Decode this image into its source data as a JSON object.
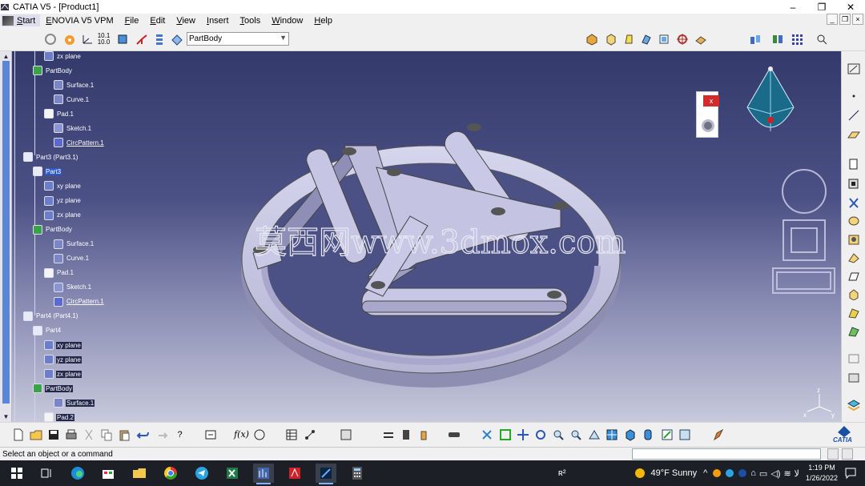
{
  "window": {
    "title": "CATIA V5 - [Product1]",
    "controls": [
      "–",
      "❐",
      "✕"
    ]
  },
  "menu": {
    "items": [
      "Start",
      "ENOVIA V5 VPM",
      "File",
      "Edit",
      "View",
      "Insert",
      "Tools",
      "Window",
      "Help"
    ]
  },
  "toolbar": {
    "combo_value": "PartBody"
  },
  "tree": {
    "nodes": [
      {
        "label": "zx plane",
        "icon": "plane-icon",
        "indent": 2
      },
      {
        "label": "PartBody",
        "icon": "partbody-icon",
        "indent": 1
      },
      {
        "label": "Surface.1",
        "icon": "surface-icon",
        "indent": 3
      },
      {
        "label": "Curve.1",
        "icon": "curve-icon",
        "indent": 3
      },
      {
        "label": "Pad.1",
        "icon": "pad-icon",
        "indent": 2
      },
      {
        "label": "Sketch.1",
        "icon": "sketch-icon",
        "indent": 3
      },
      {
        "label": "CircPattern.1",
        "icon": "pattern-icon",
        "indent": 3,
        "style": "link"
      },
      {
        "label": "Part3 (Part3.1)",
        "icon": "part-icon",
        "indent": 0
      },
      {
        "label": "Part3",
        "icon": "part-icon",
        "indent": 1,
        "style": "selected"
      },
      {
        "label": "xy plane",
        "icon": "plane-icon",
        "indent": 2
      },
      {
        "label": "yz plane",
        "icon": "plane-icon",
        "indent": 2
      },
      {
        "label": "zx plane",
        "icon": "plane-icon",
        "indent": 2
      },
      {
        "label": "PartBody",
        "icon": "partbody-icon",
        "indent": 1
      },
      {
        "label": "Surface.1",
        "icon": "surface-icon",
        "indent": 3
      },
      {
        "label": "Curve.1",
        "icon": "curve-icon",
        "indent": 3
      },
      {
        "label": "Pad.1",
        "icon": "pad-icon",
        "indent": 2
      },
      {
        "label": "Sketch.1",
        "icon": "sketch-icon",
        "indent": 3
      },
      {
        "label": "CircPattern.1",
        "icon": "pattern-icon",
        "indent": 3,
        "style": "link"
      },
      {
        "label": "Part4 (Part4.1)",
        "icon": "part-icon",
        "indent": 0
      },
      {
        "label": "Part4",
        "icon": "part-icon",
        "indent": 1
      },
      {
        "label": "xy plane",
        "icon": "plane-icon",
        "indent": 2,
        "style": "hl"
      },
      {
        "label": "yz plane",
        "icon": "plane-icon",
        "indent": 2,
        "style": "hl"
      },
      {
        "label": "zx plane",
        "icon": "plane-icon",
        "indent": 2,
        "style": "hl"
      },
      {
        "label": "PartBody",
        "icon": "partbody-icon",
        "indent": 1,
        "style": "hl"
      },
      {
        "label": "Surface.1",
        "icon": "surface-icon",
        "indent": 3,
        "style": "hl"
      },
      {
        "label": "Pad.2",
        "icon": "pad-icon",
        "indent": 2,
        "style": "hl"
      }
    ]
  },
  "viewport": {
    "watermark": "莫西网www.3dmox.com",
    "axis_labels": [
      "z",
      "x",
      "y"
    ]
  },
  "status": {
    "message": "Select an object or a command"
  },
  "taskbar": {
    "weather": "49°F  Sunny",
    "time": "1:19 PM",
    "date": "1/26/2022",
    "apps": [
      "start-icon",
      "task-view-icon",
      "edge-icon",
      "store-icon",
      "explorer-icon",
      "chrome-icon",
      "telegram-icon",
      "excel-icon",
      "catia-icon",
      "acrobat-icon",
      "photoshop-icon",
      "calculator-icon"
    ]
  },
  "colors": {
    "accent": "#2f58c9",
    "bg_top": "#333a6b",
    "bg_bottom": "#c8c9dc",
    "model": "#c9c8e6"
  }
}
